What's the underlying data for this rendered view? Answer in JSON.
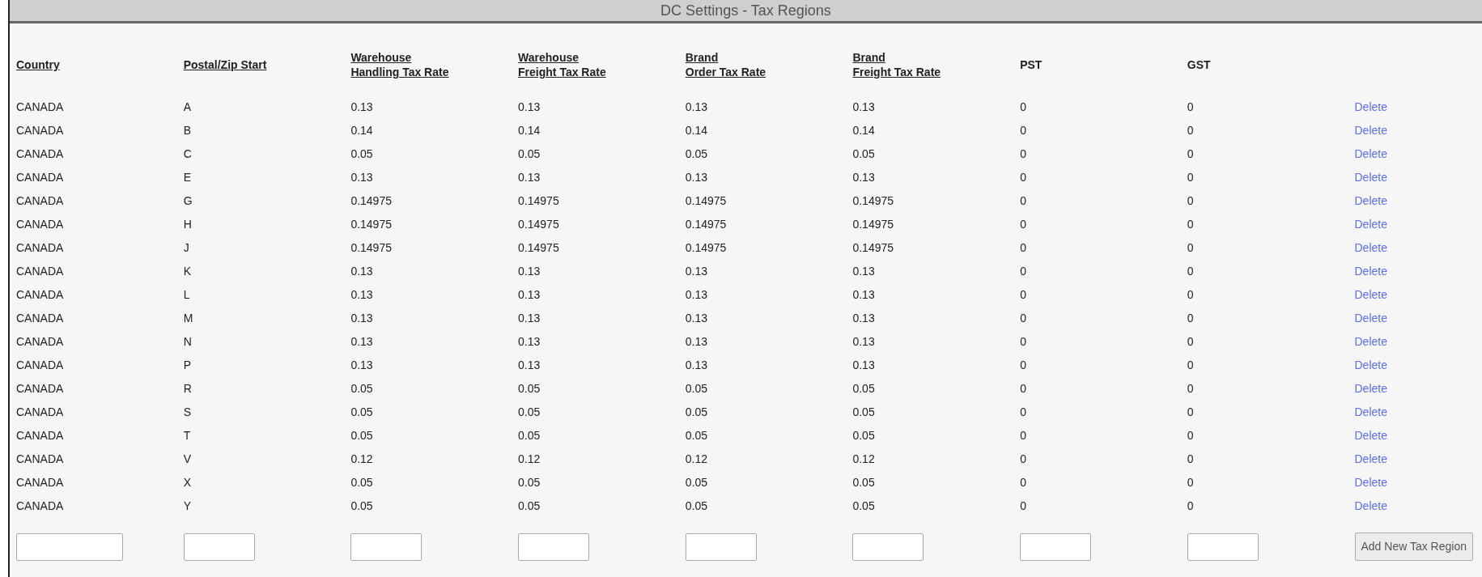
{
  "title": "DC Settings - Tax Regions",
  "columns": [
    {
      "label": "Country",
      "underlined": true
    },
    {
      "label": "Postal/Zip Start",
      "underlined": true
    },
    {
      "label": "Warehouse\nHandling Tax Rate",
      "underlined": true
    },
    {
      "label": "Warehouse\nFreight Tax Rate",
      "underlined": true
    },
    {
      "label": "Brand\nOrder Tax Rate",
      "underlined": true
    },
    {
      "label": "Brand\nFreight Tax Rate",
      "underlined": true
    },
    {
      "label": "PST",
      "underlined": false
    },
    {
      "label": "GST",
      "underlined": false
    }
  ],
  "rows": [
    {
      "cells": [
        "CANADA",
        "A",
        "0.13",
        "0.13",
        "0.13",
        "0.13",
        "0",
        "0"
      ],
      "action": "Delete"
    },
    {
      "cells": [
        "CANADA",
        "B",
        "0.14",
        "0.14",
        "0.14",
        "0.14",
        "0",
        "0"
      ],
      "action": "Delete"
    },
    {
      "cells": [
        "CANADA",
        "C",
        "0.05",
        "0.05",
        "0.05",
        "0.05",
        "0",
        "0"
      ],
      "action": "Delete"
    },
    {
      "cells": [
        "CANADA",
        "E",
        "0.13",
        "0.13",
        "0.13",
        "0.13",
        "0",
        "0"
      ],
      "action": "Delete"
    },
    {
      "cells": [
        "CANADA",
        "G",
        "0.14975",
        "0.14975",
        "0.14975",
        "0.14975",
        "0",
        "0"
      ],
      "action": "Delete"
    },
    {
      "cells": [
        "CANADA",
        "H",
        "0.14975",
        "0.14975",
        "0.14975",
        "0.14975",
        "0",
        "0"
      ],
      "action": "Delete"
    },
    {
      "cells": [
        "CANADA",
        "J",
        "0.14975",
        "0.14975",
        "0.14975",
        "0.14975",
        "0",
        "0"
      ],
      "action": "Delete"
    },
    {
      "cells": [
        "CANADA",
        "K",
        "0.13",
        "0.13",
        "0.13",
        "0.13",
        "0",
        "0"
      ],
      "action": "Delete"
    },
    {
      "cells": [
        "CANADA",
        "L",
        "0.13",
        "0.13",
        "0.13",
        "0.13",
        "0",
        "0"
      ],
      "action": "Delete"
    },
    {
      "cells": [
        "CANADA",
        "M",
        "0.13",
        "0.13",
        "0.13",
        "0.13",
        "0",
        "0"
      ],
      "action": "Delete"
    },
    {
      "cells": [
        "CANADA",
        "N",
        "0.13",
        "0.13",
        "0.13",
        "0.13",
        "0",
        "0"
      ],
      "action": "Delete"
    },
    {
      "cells": [
        "CANADA",
        "P",
        "0.13",
        "0.13",
        "0.13",
        "0.13",
        "0",
        "0"
      ],
      "action": "Delete"
    },
    {
      "cells": [
        "CANADA",
        "R",
        "0.05",
        "0.05",
        "0.05",
        "0.05",
        "0",
        "0"
      ],
      "action": "Delete"
    },
    {
      "cells": [
        "CANADA",
        "S",
        "0.05",
        "0.05",
        "0.05",
        "0.05",
        "0",
        "0"
      ],
      "action": "Delete"
    },
    {
      "cells": [
        "CANADA",
        "T",
        "0.05",
        "0.05",
        "0.05",
        "0.05",
        "0",
        "0"
      ],
      "action": "Delete"
    },
    {
      "cells": [
        "CANADA",
        "V",
        "0.12",
        "0.12",
        "0.12",
        "0.12",
        "0",
        "0"
      ],
      "action": "Delete"
    },
    {
      "cells": [
        "CANADA",
        "X",
        "0.05",
        "0.05",
        "0.05",
        "0.05",
        "0",
        "0"
      ],
      "action": "Delete"
    },
    {
      "cells": [
        "CANADA",
        "Y",
        "0.05",
        "0.05",
        "0.05",
        "0.05",
        "0",
        "0"
      ],
      "action": "Delete"
    }
  ],
  "new_row": {
    "fields": [
      {
        "kind": "wide"
      },
      {
        "kind": "narrow"
      },
      {
        "kind": "narrow"
      },
      {
        "kind": "narrow"
      },
      {
        "kind": "narrow"
      },
      {
        "kind": "narrow"
      },
      {
        "kind": "narrow"
      },
      {
        "kind": "narrow"
      }
    ],
    "button": "Add New Tax Region"
  }
}
